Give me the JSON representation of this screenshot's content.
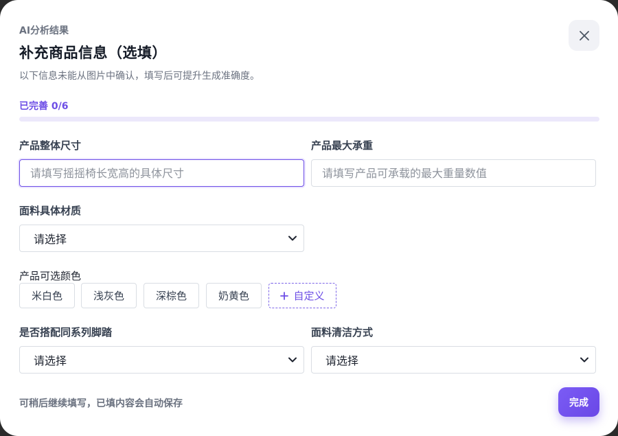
{
  "header": {
    "eyebrow": "AI分析结果",
    "title": "补充商品信息（选填）",
    "subtitle": "以下信息未能从图片中确认，填写后可提升生成准确度。"
  },
  "progress": {
    "label": "已完善 0/6",
    "completed": 0,
    "total": 6
  },
  "fields": {
    "size": {
      "label": "产品整体尺寸",
      "value": "",
      "placeholder": "请填写摇摇椅长宽高的具体尺寸"
    },
    "max_weight": {
      "label": "产品最大承重",
      "value": "",
      "placeholder": "请填写产品可承载的最大重量数值"
    },
    "material": {
      "label": "面料具体材质",
      "selected": "请选择"
    },
    "colors": {
      "label": "产品可选颜色",
      "options": [
        "米白色",
        "浅灰色",
        "深棕色",
        "奶黄色"
      ],
      "custom_label": "自定义"
    },
    "footrest": {
      "label": "是否搭配同系列脚踏",
      "selected": "请选择"
    },
    "cleaning": {
      "label": "面料清洁方式",
      "selected": "请选择"
    }
  },
  "footer": {
    "note": "可稍后继续填写，已填内容会自动保存",
    "done_label": "完成"
  },
  "colors": {
    "accent": "#6d4ee6",
    "muted_text": "#6b7280"
  },
  "icons": {
    "close": "close-icon",
    "chevron": "chevron-down-icon",
    "plus": "plus-icon"
  }
}
